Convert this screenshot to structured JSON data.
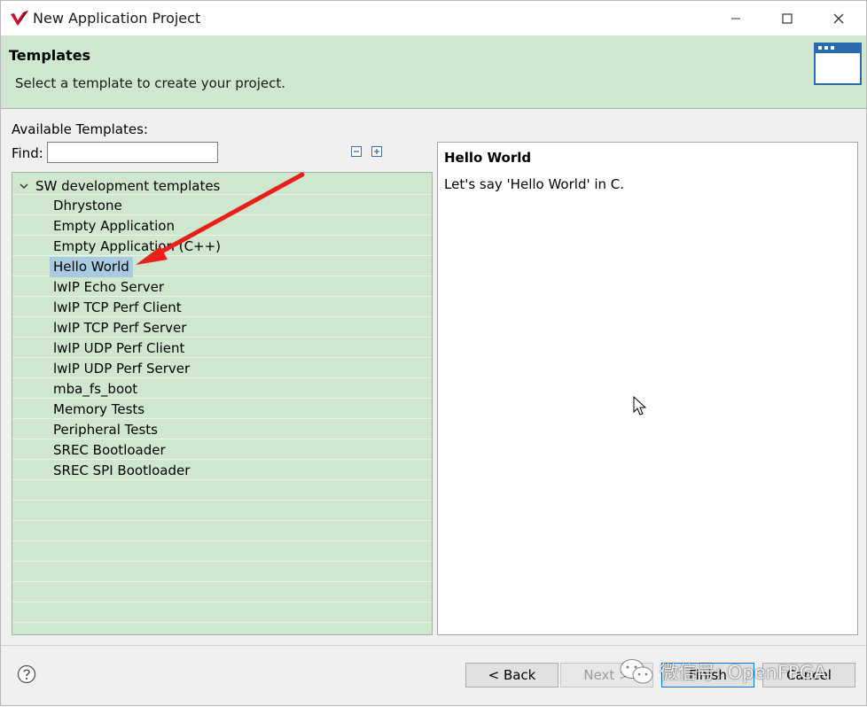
{
  "window": {
    "title": "New Application Project"
  },
  "banner": {
    "title": "Templates",
    "description": "Select a template to create your project."
  },
  "templates": {
    "available_label": "Available Templates:",
    "find_label": "Find:",
    "find_value": "",
    "group": "SW development templates",
    "items": [
      "Dhrystone",
      "Empty Application",
      "Empty Application (C++)",
      "Hello World",
      "lwIP Echo Server",
      "lwIP TCP Perf Client",
      "lwIP TCP Perf Server",
      "lwIP UDP Perf Client",
      "lwIP UDP Perf Server",
      "mba_fs_boot",
      "Memory Tests",
      "Peripheral Tests",
      "SREC Bootloader",
      "SREC SPI Bootloader"
    ],
    "selected": "Hello World"
  },
  "description": {
    "title": "Hello World",
    "text": "Let's say 'Hello World' in C."
  },
  "buttons": {
    "back": "< Back",
    "next": "Next >",
    "finish": "Finish",
    "cancel": "Cancel"
  },
  "watermark": {
    "text": "微信号: OpenFPGA"
  },
  "colors": {
    "banner_bg": "#cfe7cf",
    "tree_bg": "#cfe7cf",
    "selection": "#a8cbe0",
    "annotation_arrow": "#e8201c"
  }
}
